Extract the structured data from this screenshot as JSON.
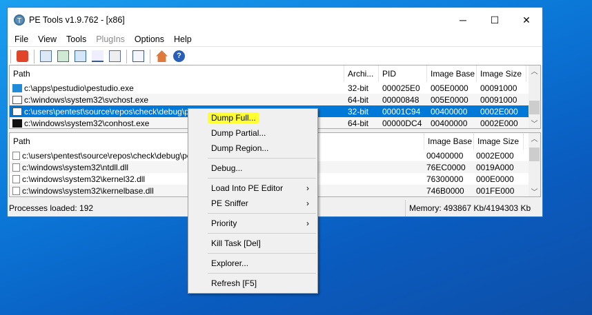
{
  "window": {
    "title": "PE Tools v1.9.762 - [x86]",
    "minimize": "─",
    "maximize": "☐",
    "close": "✕"
  },
  "menu": [
    "File",
    "View",
    "Tools",
    "PlugIns",
    "Options",
    "Help"
  ],
  "processes": {
    "headers": [
      "Path",
      "Archi...",
      "PID",
      "Image Base",
      "Image Size"
    ],
    "rows": [
      {
        "path": "c:\\apps\\pestudio\\pestudio.exe",
        "arch": "32-bit",
        "pid": "000025E0",
        "base": "005E0000",
        "size": "00091000"
      },
      {
        "path": "c:\\windows\\system32\\svchost.exe",
        "arch": "64-bit",
        "pid": "00000848",
        "base": "005E0000",
        "size": "00091000"
      },
      {
        "path": "c:\\users\\pentest\\source\\repos\\check\\debug\\pcheck.exe",
        "arch": "32-bit",
        "pid": "00001C94",
        "base": "00400000",
        "size": "0002E000"
      },
      {
        "path": "c:\\windows\\system32\\conhost.exe",
        "arch": "64-bit",
        "pid": "00000DC4",
        "base": "00400000",
        "size": "0002E000"
      }
    ]
  },
  "modules": {
    "headers": [
      "Path",
      "Image Base",
      "Image Size"
    ],
    "rows": [
      {
        "path": "c:\\users\\pentest\\source\\repos\\check\\debug\\pcheck.exe",
        "base": "00400000",
        "size": "0002E000"
      },
      {
        "path": "c:\\windows\\system32\\ntdll.dll",
        "base": "76EC0000",
        "size": "0019A000"
      },
      {
        "path": "c:\\windows\\system32\\kernel32.dll",
        "base": "76300000",
        "size": "000E0000"
      },
      {
        "path": "c:\\windows\\system32\\kernelbase.dll",
        "base": "746B0000",
        "size": "001FE000"
      }
    ]
  },
  "status": {
    "left": "Processes loaded: 192",
    "right": "Memory: 493867 Kb/4194303 Kb"
  },
  "context_menu": [
    "Dump Full...",
    "Dump Partial...",
    "Dump Region...",
    "Debug...",
    "Load Into PE Editor",
    "PE Sniffer",
    "Priority",
    "Kill Task  [Del]",
    "Explorer...",
    "Refresh  [F5]"
  ]
}
